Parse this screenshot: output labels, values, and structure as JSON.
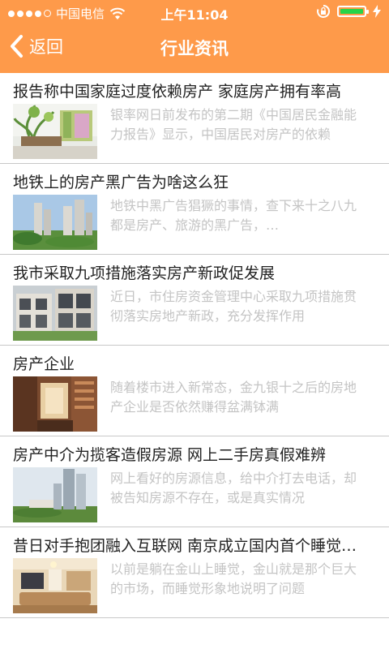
{
  "status_bar": {
    "carrier": "中国电信",
    "time": "上午11:04"
  },
  "nav": {
    "back_label": "返回",
    "title": "行业资讯"
  },
  "colors": {
    "accent": "#fe9a4a",
    "battery": "#27d44a",
    "summary_text": "#c4c4c4"
  },
  "articles": [
    {
      "title": "报告称中国家庭过度依赖房产 家庭房产拥有率高",
      "summary": "银率网日前发布的第二期《中国居民金融能力报告》显示，中国居民对房产的依赖"
    },
    {
      "title": "地铁上的房产黑广告为啥这么狂",
      "summary": "地铁中黑广告猖獗的事情，查下来十之八九都是房产、旅游的黑广告，…"
    },
    {
      "title": "我市采取九项措施落实房产新政促发展",
      "summary": "近日，市住房资金管理中心采取九项措施贯彻落实房地产新政，充分发挥作用"
    },
    {
      "title": "房产企业",
      "summary": "随着楼市进入新常态，金九银十之后的房地产企业是否依然赚得盆满钵满"
    },
    {
      "title": "房产中介为揽客造假房源 网上二手房真假难辨",
      "summary": "网上看好的房源信息，给中介打去电话，却被告知房源不存在，或是真实情况"
    },
    {
      "title": "昔日对手抱团融入互联网 南京成立国内首个睡觉产业",
      "summary": "以前是躺在金山上睡觉，金山就是那个巨大的市场，而睡觉形象地说明了问题"
    }
  ]
}
